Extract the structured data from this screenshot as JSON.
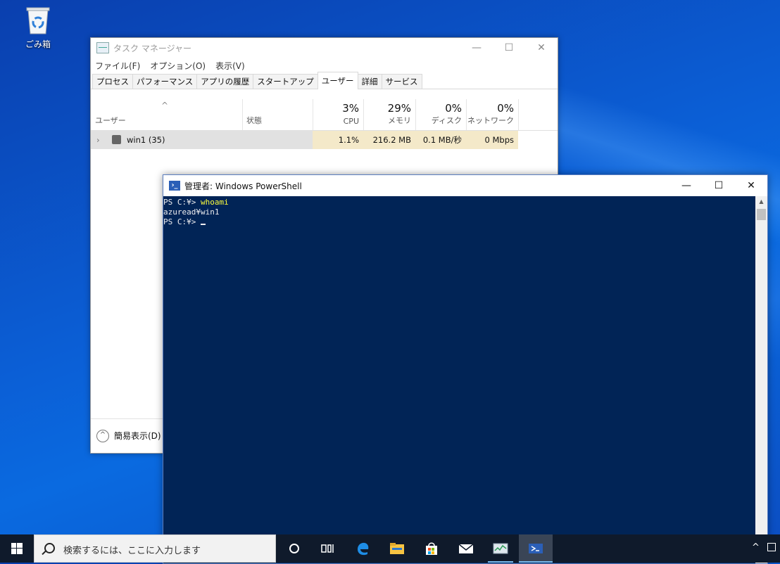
{
  "desktop": {
    "recycle_bin_label": "ごみ箱"
  },
  "task_manager": {
    "title": "タスク マネージャー",
    "menu": [
      "ファイル(F)",
      "オプション(O)",
      "表示(V)"
    ],
    "tabs": [
      "プロセス",
      "パフォーマンス",
      "アプリの履歴",
      "スタートアップ",
      "ユーザー",
      "詳細",
      "サービス"
    ],
    "active_tab": "ユーザー",
    "columns": {
      "user": "ユーザー",
      "status": "状態",
      "cpu": {
        "pct": "3%",
        "label": "CPU"
      },
      "memory": {
        "pct": "29%",
        "label": "メモリ"
      },
      "disk": {
        "pct": "0%",
        "label": "ディスク"
      },
      "network": {
        "pct": "0%",
        "label": "ネットワーク"
      }
    },
    "rows": [
      {
        "name": "win1 (35)",
        "status": "",
        "cpu": "1.1%",
        "memory": "216.2 MB",
        "disk": "0.1 MB/秒",
        "network": "0 Mbps"
      }
    ],
    "fewer_details": "簡易表示(D)"
  },
  "powershell": {
    "title": "管理者: Windows PowerShell",
    "lines": [
      {
        "prompt": "PS C:¥> ",
        "cmd": "whoami"
      },
      {
        "prompt": "azuread¥win1",
        "cmd": ""
      },
      {
        "prompt": "PS C:¥> ",
        "cmd": ""
      }
    ]
  },
  "taskbar": {
    "search_placeholder": "検索するには、ここに入力します",
    "icons": [
      "cortana-icon",
      "task-view-icon",
      "edge-icon",
      "file-explorer-icon",
      "store-icon",
      "mail-icon",
      "task-manager-icon",
      "powershell-icon"
    ]
  },
  "colors": {
    "console_bg": "#012456",
    "console_cmd": "#fdfd3d",
    "taskbar_bg": "#0f1a2b"
  }
}
